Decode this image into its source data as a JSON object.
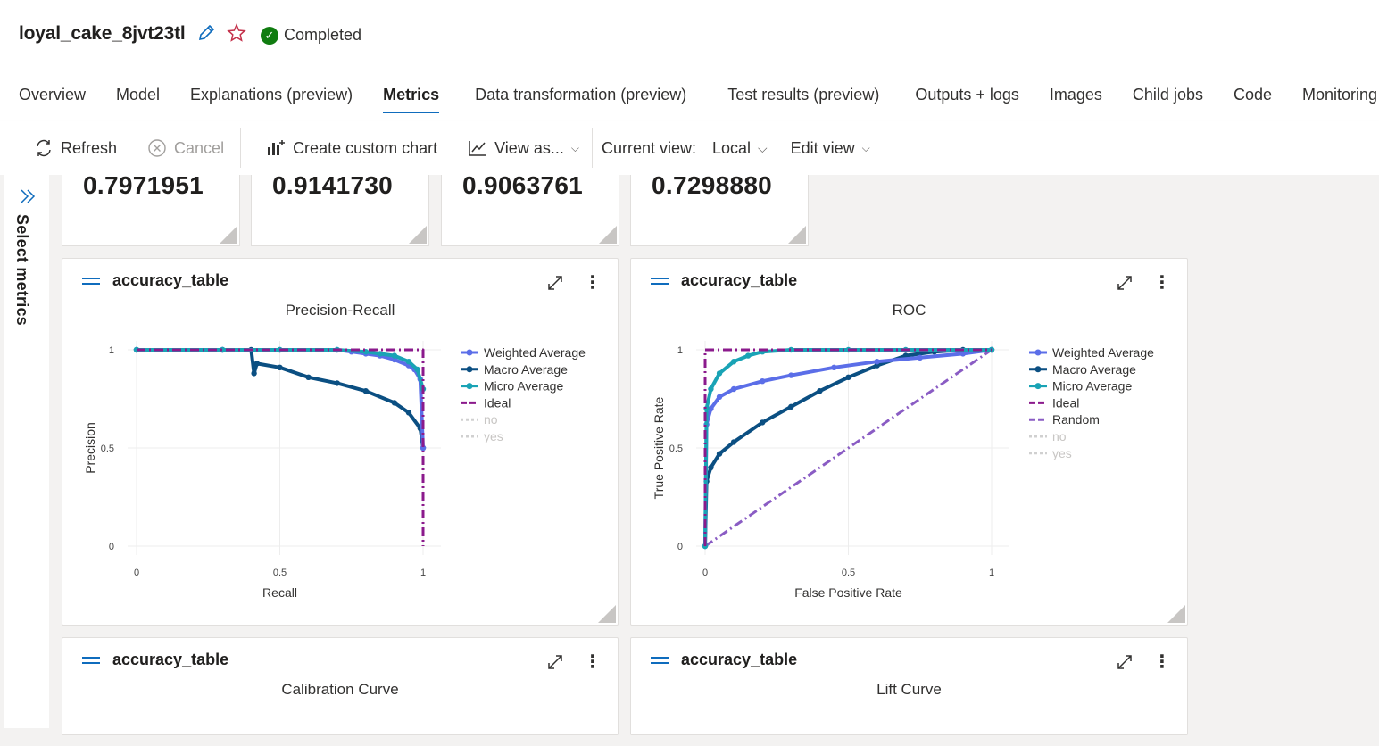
{
  "job": {
    "name": "loyal_cake_8jvt23tl",
    "status": "Completed"
  },
  "tabs": [
    {
      "label": "Overview"
    },
    {
      "label": "Model"
    },
    {
      "label": "Explanations (preview)"
    },
    {
      "label": "Metrics"
    },
    {
      "label": "Data transformation (preview)"
    },
    {
      "label": "Test results (preview)"
    },
    {
      "label": "Outputs + logs"
    },
    {
      "label": "Images"
    },
    {
      "label": "Child jobs"
    },
    {
      "label": "Code"
    },
    {
      "label": "Monitoring"
    }
  ],
  "active_tab": "Metrics",
  "toolbar": {
    "refresh": "Refresh",
    "cancel": "Cancel",
    "create_chart": "Create custom chart",
    "view_as": "View as...",
    "current_view_label": "Current view:",
    "current_view_value": "Local",
    "edit_view": "Edit view"
  },
  "sidebar": {
    "label": "Select metrics"
  },
  "metric_tiles": [
    {
      "value": "0.7971951"
    },
    {
      "value": "0.9141730"
    },
    {
      "value": "0.9063761"
    },
    {
      "value": "0.7298880"
    }
  ],
  "cards": [
    {
      "name": "accuracy_table",
      "chart_title": "Precision-Recall"
    },
    {
      "name": "accuracy_table",
      "chart_title": "ROC"
    },
    {
      "name": "accuracy_table",
      "chart_title": "Calibration Curve"
    },
    {
      "name": "accuracy_table",
      "chart_title": "Lift Curve"
    }
  ],
  "colors": {
    "weighted": "#5b6ee8",
    "macro": "#0b4f82",
    "micro": "#19a3b5",
    "ideal": "#8b1a8c",
    "random": "#8a5cc4",
    "disabled": "#d0d0d0",
    "accent": "#0f6cbd"
  },
  "chart_data": [
    {
      "type": "line",
      "title": "Precision-Recall",
      "xlabel": "Recall",
      "ylabel": "Precision",
      "xlim": [
        0,
        1
      ],
      "ylim": [
        0,
        1
      ],
      "xticks": [
        "0",
        "0.5",
        "1"
      ],
      "yticks": [
        "0",
        "0.5",
        "1"
      ],
      "legend_position": "right",
      "series": [
        {
          "name": "Weighted Average",
          "x": [
            0,
            0.3,
            0.5,
            0.7,
            0.75,
            0.8,
            0.85,
            0.9,
            0.95,
            0.97,
            0.99,
            1.0
          ],
          "y": [
            1,
            1,
            1,
            1,
            0.99,
            0.98,
            0.97,
            0.95,
            0.92,
            0.9,
            0.85,
            0.5
          ]
        },
        {
          "name": "Macro Average",
          "x": [
            0,
            0.3,
            0.4,
            0.41,
            0.42,
            0.5,
            0.6,
            0.7,
            0.8,
            0.9,
            0.95,
            0.99,
            1.0
          ],
          "y": [
            1,
            1,
            1,
            0.88,
            0.93,
            0.91,
            0.86,
            0.83,
            0.79,
            0.73,
            0.68,
            0.6,
            0.5
          ]
        },
        {
          "name": "Micro Average",
          "x": [
            0,
            0.3,
            0.5,
            0.7,
            0.8,
            0.85,
            0.9,
            0.95,
            0.98,
            1.0
          ],
          "y": [
            1,
            1,
            1,
            1,
            0.99,
            0.98,
            0.97,
            0.94,
            0.9,
            0.8
          ]
        },
        {
          "name": "Ideal",
          "x": [
            0,
            1,
            1
          ],
          "y": [
            1,
            1,
            0
          ]
        },
        {
          "name": "no",
          "x": [],
          "y": []
        },
        {
          "name": "yes",
          "x": [],
          "y": []
        }
      ]
    },
    {
      "type": "line",
      "title": "ROC",
      "xlabel": "False Positive Rate",
      "ylabel": "True Positive Rate",
      "xlim": [
        0,
        1
      ],
      "ylim": [
        0,
        1
      ],
      "xticks": [
        "0",
        "0.5",
        "1"
      ],
      "yticks": [
        "0",
        "0.5",
        "1"
      ],
      "legend_position": "right",
      "series": [
        {
          "name": "Weighted Average",
          "x": [
            0,
            0.005,
            0.02,
            0.05,
            0.1,
            0.2,
            0.3,
            0.45,
            0.6,
            0.75,
            0.9,
            1.0
          ],
          "y": [
            0,
            0.62,
            0.7,
            0.76,
            0.8,
            0.84,
            0.87,
            0.91,
            0.94,
            0.96,
            0.98,
            1.0
          ]
        },
        {
          "name": "Macro Average",
          "x": [
            0,
            0.005,
            0.02,
            0.05,
            0.1,
            0.2,
            0.3,
            0.4,
            0.5,
            0.6,
            0.7,
            0.8,
            0.9,
            1.0
          ],
          "y": [
            0,
            0.33,
            0.4,
            0.47,
            0.53,
            0.63,
            0.71,
            0.79,
            0.86,
            0.92,
            0.97,
            0.99,
            1.0,
            1.0
          ]
        },
        {
          "name": "Micro Average",
          "x": [
            0,
            0.005,
            0.02,
            0.05,
            0.1,
            0.15,
            0.2,
            0.3,
            0.5,
            0.7,
            1.0
          ],
          "y": [
            0,
            0.7,
            0.8,
            0.88,
            0.94,
            0.97,
            0.99,
            1.0,
            1.0,
            1.0,
            1.0
          ]
        },
        {
          "name": "Ideal",
          "x": [
            0,
            0,
            1
          ],
          "y": [
            0,
            1,
            1
          ]
        },
        {
          "name": "Random",
          "x": [
            0,
            1
          ],
          "y": [
            0,
            1
          ]
        },
        {
          "name": "no",
          "x": [],
          "y": []
        },
        {
          "name": "yes",
          "x": [],
          "y": []
        }
      ]
    }
  ]
}
